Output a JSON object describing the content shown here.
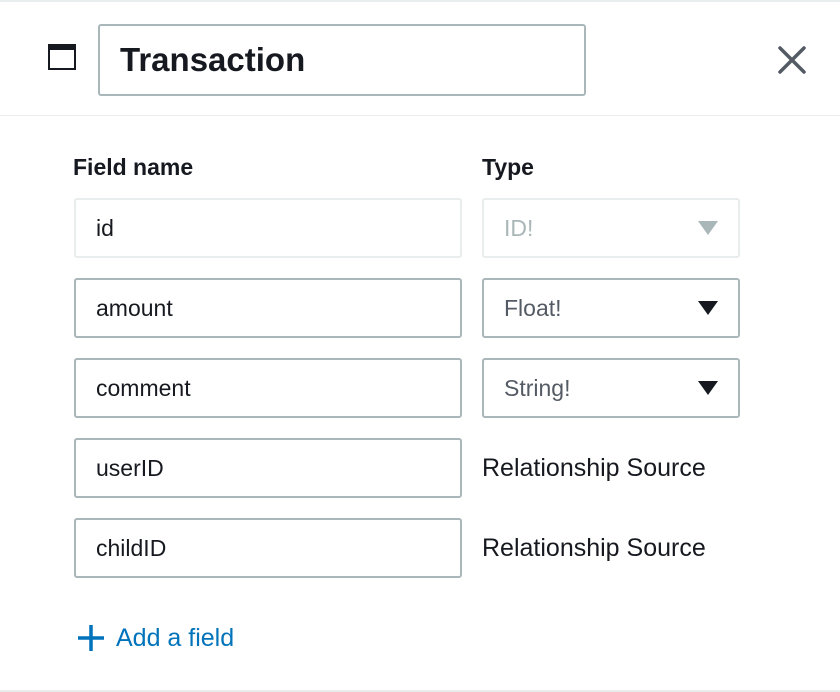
{
  "model": {
    "name": "Transaction"
  },
  "columns": {
    "field_name": "Field name",
    "type": "Type"
  },
  "fields": [
    {
      "name": "id",
      "type": "ID!"
    },
    {
      "name": "amount",
      "type": "Float!"
    },
    {
      "name": "comment",
      "type": "String!"
    },
    {
      "name": "userID",
      "type": "Relationship Source"
    },
    {
      "name": "childID",
      "type": "Relationship Source"
    }
  ],
  "add_field_label": "Add a field",
  "colors": {
    "link": "#0073bb",
    "border": "#aab7b8",
    "text": "#16191f",
    "muted": "#aab7b8"
  },
  "icons": {
    "model": "model-window-icon",
    "close": "close-icon",
    "add": "plus-icon",
    "dropdown": "caret-down-icon"
  }
}
